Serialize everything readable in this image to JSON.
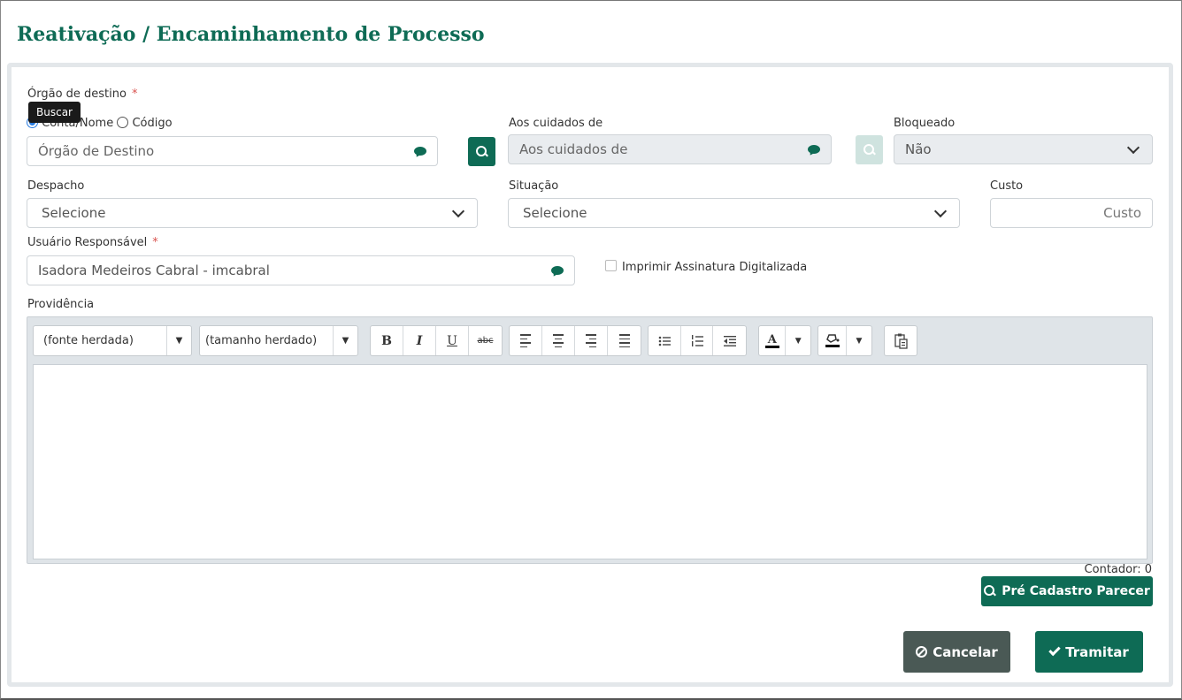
{
  "page": {
    "title": "Reativação / Encaminhamento de Processo"
  },
  "form": {
    "orgao": {
      "label": "Órgão de destino",
      "required_mark": "*",
      "tooltip": "Buscar",
      "radio_conta": "Conta/Nome",
      "radio_codigo": "Código",
      "placeholder": "Órgão de Destino"
    },
    "aos_cuidados": {
      "label": "Aos cuidados de",
      "placeholder": "Aos cuidados de"
    },
    "bloqueado": {
      "label": "Bloqueado",
      "value": "Não"
    },
    "despacho": {
      "label": "Despacho",
      "value": "Selecione"
    },
    "situacao": {
      "label": "Situação",
      "value": "Selecione"
    },
    "custo": {
      "label": "Custo",
      "placeholder": "Custo"
    },
    "usuario": {
      "label": "Usuário Responsável",
      "required_mark": "*",
      "value": "Isadora Medeiros Cabral - imcabral"
    },
    "imprimir": {
      "label": "Imprimir Assinatura Digitalizada"
    },
    "providencia": {
      "label": "Providência",
      "font_combo": "(fonte herdada)",
      "size_combo": "(tamanho herdado)",
      "contador": "Contador: 0"
    }
  },
  "toolbar_icons": {
    "bold": "B",
    "italic": "I",
    "underline": "U",
    "strike": "abc",
    "text_color": "A",
    "dropdown": "▼"
  },
  "buttons": {
    "pre_cadastro": "Pré Cadastro Parecer",
    "cancelar": "Cancelar",
    "tramitar": "Tramitar"
  },
  "colors": {
    "brand": "#0e6b55",
    "cancel": "#4a5955"
  }
}
